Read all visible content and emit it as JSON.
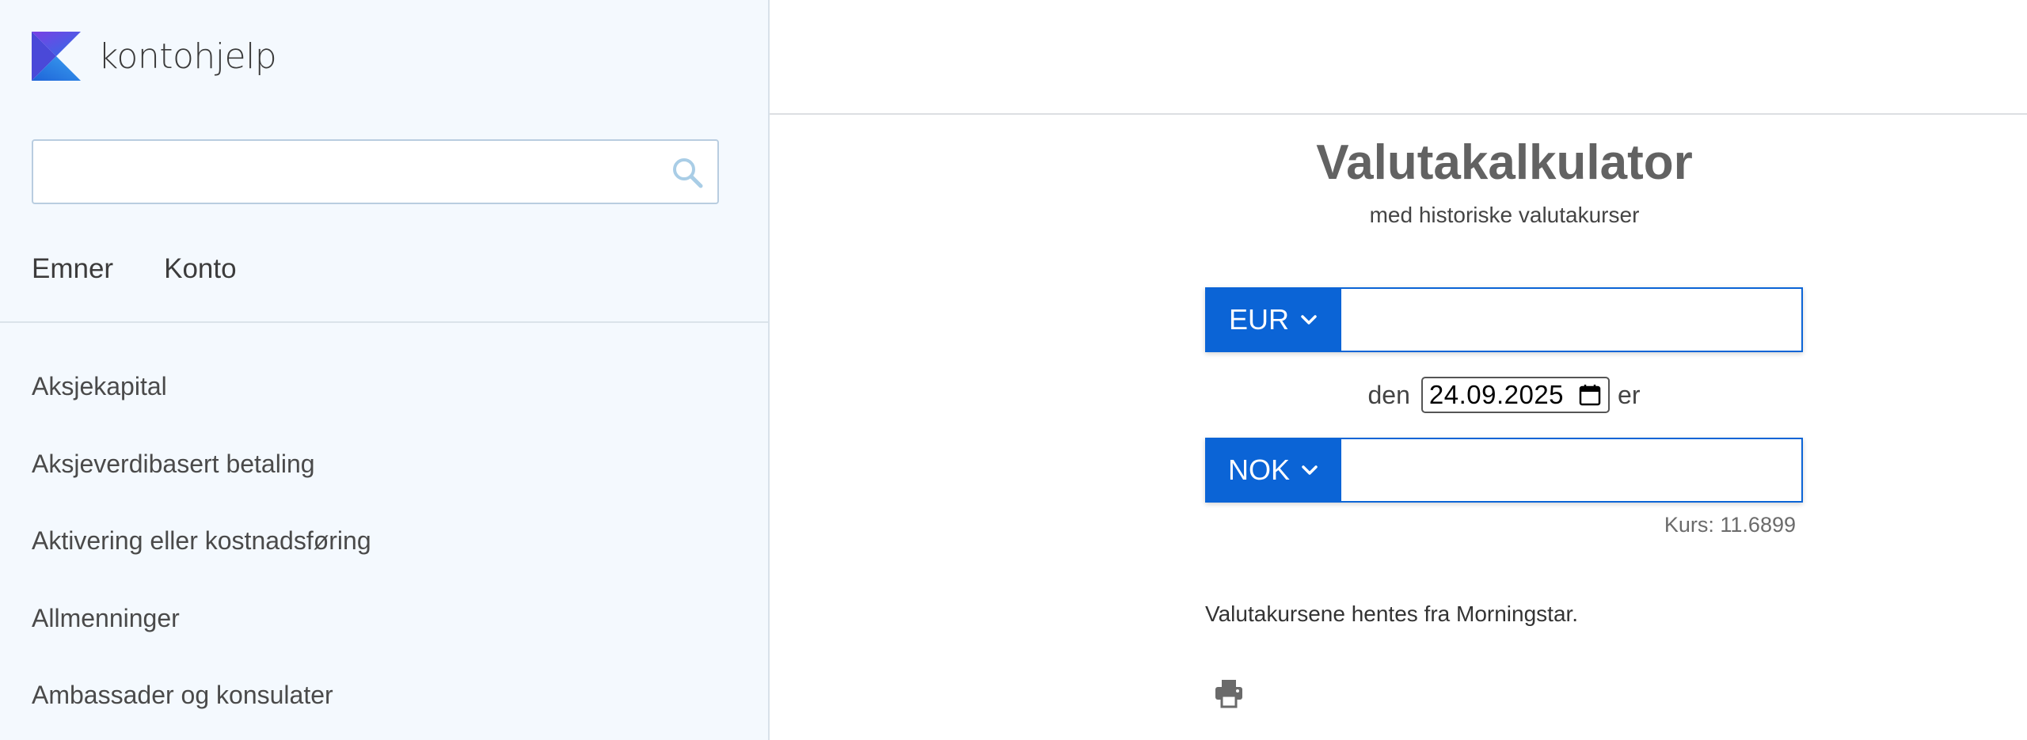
{
  "brand": {
    "name": "kontohjelp",
    "logo_icon": "k-logo-icon"
  },
  "search": {
    "placeholder": "",
    "value": ""
  },
  "nav": {
    "tabs": [
      {
        "label": "Emner"
      },
      {
        "label": "Konto"
      }
    ]
  },
  "topics": [
    {
      "label": "Aksjekapital"
    },
    {
      "label": "Aksjeverdibasert betaling"
    },
    {
      "label": "Aktivering eller kostnadsføring"
    },
    {
      "label": "Allmenninger"
    },
    {
      "label": "Ambassader og konsulater"
    }
  ],
  "calculator": {
    "title": "Valutakalkulator",
    "subtitle": "med historiske valutakurser",
    "from_currency": "EUR",
    "from_amount": "",
    "date_prefix": "den",
    "date_value": "24.09.2025",
    "date_suffix": "er",
    "to_currency": "NOK",
    "to_amount": "",
    "rate": "Kurs: 11.6899",
    "source": "Valutakursene hentes fra Morningstar."
  },
  "colors": {
    "accent": "#0b64d6",
    "sidebar_bg": "#f4f9fe"
  }
}
